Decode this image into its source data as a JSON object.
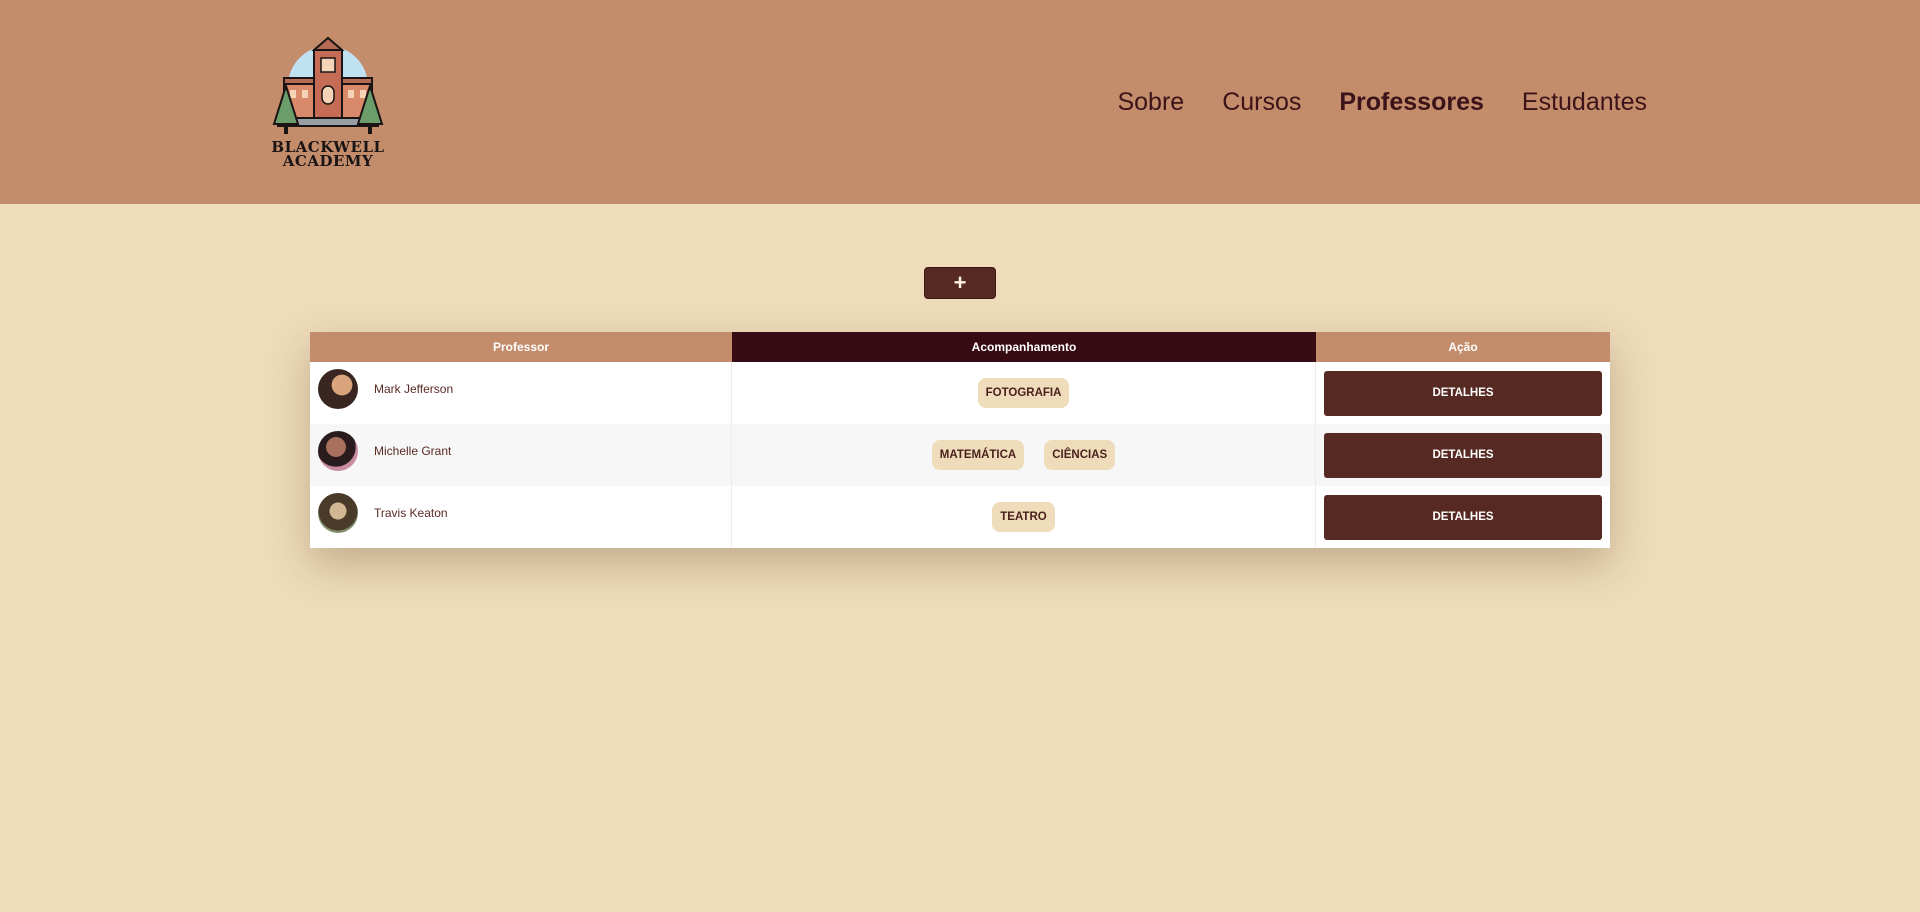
{
  "header": {
    "logo": {
      "line1": "BLACKWELL",
      "line2": "ACADEMY"
    },
    "nav": [
      {
        "label": "Sobre",
        "active": false
      },
      {
        "label": "Cursos",
        "active": false
      },
      {
        "label": "Professores",
        "active": true
      },
      {
        "label": "Estudantes",
        "active": false
      }
    ]
  },
  "main": {
    "add_button": "+",
    "table": {
      "columns": [
        "Professor",
        "Acompanhamento",
        "Ação"
      ],
      "rows": [
        {
          "name": "Mark Jefferson",
          "tags": [
            "FOTOGRAFIA"
          ],
          "action": "DETALHES"
        },
        {
          "name": "Michelle Grant",
          "tags": [
            "MATEMÁTICA",
            "CIÊNCIAS"
          ],
          "action": "DETALHES"
        },
        {
          "name": "Travis Keaton",
          "tags": [
            "TEATRO"
          ],
          "action": "DETALHES"
        }
      ]
    }
  },
  "colors": {
    "header_bg": "#C38C6B",
    "page_bg": "#EEDCBA",
    "dark_header": "#370B14",
    "button": "#562922",
    "nav_text": "#3B1319"
  },
  "icons": {
    "logo": "academy-building-logo",
    "add": "plus-icon"
  }
}
